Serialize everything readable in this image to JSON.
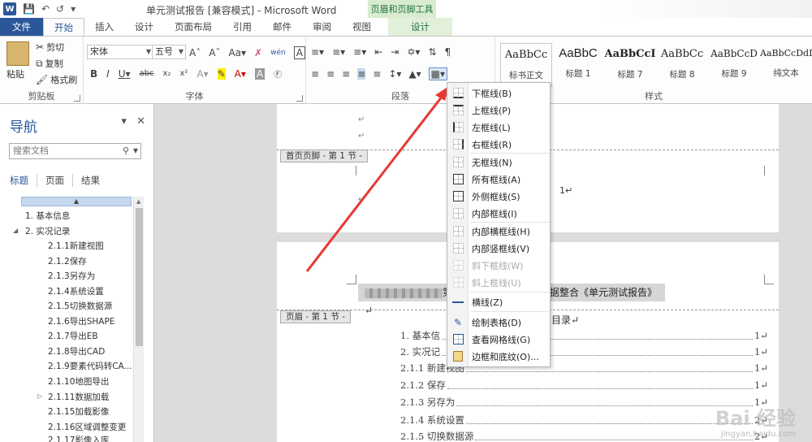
{
  "window": {
    "title": "单元测试报告 [兼容模式] - Microsoft Word",
    "context_tool": "页眉和页脚工具",
    "word_icon_letter": "W"
  },
  "tabs": [
    {
      "label": "文件"
    },
    {
      "label": "开始"
    },
    {
      "label": "插入"
    },
    {
      "label": "设计"
    },
    {
      "label": "页面布局"
    },
    {
      "label": "引用"
    },
    {
      "label": "邮件"
    },
    {
      "label": "审阅"
    },
    {
      "label": "视图"
    },
    {
      "label": "设计"
    }
  ],
  "ribbon": {
    "clipboard": {
      "paste": "粘贴",
      "cut": "剪切",
      "copy": "复制",
      "format_painter": "格式刷",
      "label": "剪贴板"
    },
    "font": {
      "font_name": "宋体",
      "font_size": "五号",
      "label": "字体",
      "phonetic": "wén"
    },
    "paragraph": {
      "label": "段落"
    },
    "styles": {
      "label": "样式",
      "items": [
        {
          "sample": "AaBbCc",
          "name": "标书正文"
        },
        {
          "sample": "AaBbC",
          "name": "标题 1"
        },
        {
          "sample": "AaBbCcI",
          "name": "标题 7"
        },
        {
          "sample": "AaBbCc",
          "name": "标题 8"
        },
        {
          "sample": "AaBbCcD",
          "name": "标题 9"
        },
        {
          "sample": "AaBbCcDdI",
          "name": "纯文本"
        }
      ]
    }
  },
  "nav": {
    "title": "导航",
    "search_placeholder": "搜索文档",
    "tabs": [
      "标题",
      "页面",
      "结果"
    ],
    "items": [
      {
        "label": "1. 基本信息"
      },
      {
        "label": "2. 实况记录"
      },
      {
        "label": "2.1.1新建视图"
      },
      {
        "label": "2.1.2保存"
      },
      {
        "label": "2.1.3另存为"
      },
      {
        "label": "2.1.4系统设置"
      },
      {
        "label": "2.1.5切换数据源"
      },
      {
        "label": "2.1.6导出SHAPE"
      },
      {
        "label": "2.1.7导出EB"
      },
      {
        "label": "2.1.8导出CAD"
      },
      {
        "label": "2.1.9要素代码转CA..."
      },
      {
        "label": "2.1.10地图导出"
      },
      {
        "label": "2.1.11数据加载"
      },
      {
        "label": "2.1.15加载影像"
      },
      {
        "label": "2.1.16区域调整变更"
      },
      {
        "label": "2.1.17影像入库"
      }
    ]
  },
  "document": {
    "footer_tag": "首页页脚 - 第 1 节 -",
    "header_tag": "页眉 - 第 1 节 -",
    "para_mark": "↵",
    "footer_page_number": "1↵",
    "header_text": "据整合《单元测试报告》↵",
    "header_prefix": "第",
    "toc_title": "目录↵",
    "toc": [
      {
        "label": "1. 基本信",
        "page": "1↵"
      },
      {
        "label": "2. 实况记",
        "page": "1↵"
      },
      {
        "label": "2.1.1 新建视图",
        "page": "1↵"
      },
      {
        "label": "2.1.2 保存",
        "page": "1↵"
      },
      {
        "label": "2.1.3 另存为",
        "page": "1↵"
      },
      {
        "label": "2.1.4 系统设置",
        "page": "2↵"
      },
      {
        "label": "2.1.5 切换数据源",
        "page": "2↵"
      }
    ]
  },
  "border_menu": {
    "items": [
      {
        "label": "下框线(B)",
        "enabled": true
      },
      {
        "label": "上框线(P)",
        "enabled": true
      },
      {
        "label": "左框线(L)",
        "enabled": true
      },
      {
        "label": "右框线(R)",
        "enabled": true
      },
      {
        "label": "无框线(N)",
        "enabled": true
      },
      {
        "label": "所有框线(A)",
        "enabled": true
      },
      {
        "label": "外侧框线(S)",
        "enabled": true
      },
      {
        "label": "内部框线(I)",
        "enabled": true
      },
      {
        "label": "内部横框线(H)",
        "enabled": true
      },
      {
        "label": "内部竖框线(V)",
        "enabled": true
      },
      {
        "label": "斜下框线(W)",
        "enabled": false
      },
      {
        "label": "斜上框线(U)",
        "enabled": false
      },
      {
        "label": "横线(Z)",
        "enabled": true
      },
      {
        "label": "绘制表格(D)",
        "enabled": true
      },
      {
        "label": "查看网格线(G)",
        "enabled": true
      },
      {
        "label": "边框和底纹(O)...",
        "enabled": true
      }
    ]
  },
  "colors": {
    "accent": "#2b579a",
    "context_green": "#217346",
    "arrow_red": "#e53935"
  },
  "watermark": {
    "text": "Bai 经验",
    "sub": "jingyan.baidu.com"
  }
}
